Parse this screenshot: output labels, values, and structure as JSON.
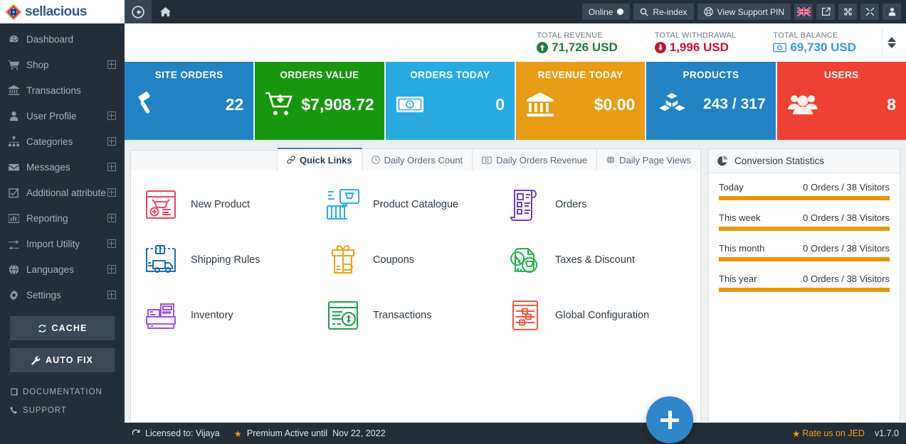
{
  "brand": {
    "name": "sellacious"
  },
  "sidebar": {
    "items": [
      {
        "label": "Dashboard",
        "icon": "dashboard-icon",
        "expandable": false
      },
      {
        "label": "Shop",
        "icon": "cart-icon",
        "expandable": true
      },
      {
        "label": "Transactions",
        "icon": "bank-icon",
        "expandable": false
      },
      {
        "label": "User Profile",
        "icon": "user-icon",
        "expandable": true
      },
      {
        "label": "Categories",
        "icon": "sitemap-icon",
        "expandable": true
      },
      {
        "label": "Messages",
        "icon": "envelope-icon",
        "expandable": true
      },
      {
        "label": "Additional attribute",
        "icon": "checkbox-icon",
        "expandable": true
      },
      {
        "label": "Reporting",
        "icon": "bar-chart-icon",
        "expandable": true
      },
      {
        "label": "Import Utility",
        "icon": "exchange-icon",
        "expandable": true
      },
      {
        "label": "Languages",
        "icon": "globe-icon",
        "expandable": true
      },
      {
        "label": "Settings",
        "icon": "gear-icon",
        "expandable": true
      }
    ],
    "buttons": [
      {
        "label": "CACHE",
        "icon": "refresh-icon"
      },
      {
        "label": "AUTO FIX",
        "icon": "wrench-icon"
      }
    ],
    "links": [
      {
        "label": "DOCUMENTATION",
        "icon": "book-icon"
      },
      {
        "label": "SUPPORT",
        "icon": "phone-icon"
      }
    ]
  },
  "topbar": {
    "back": "back-icon",
    "home": "home-icon",
    "online_label": "Online",
    "reindex_label": "Re-index",
    "support_pin_label": "View Support PIN",
    "icons": [
      "uk-flag-icon",
      "external-link-icon",
      "joomla-icon",
      "expand-icon",
      "user-icon"
    ]
  },
  "summary": [
    {
      "title": "TOTAL REVENUE",
      "value": "71,726 USD",
      "icon": "arrow-up-circle-icon",
      "color": "#1F7A3C",
      "cls": "sum-rev"
    },
    {
      "title": "TOTAL WITHDRAWAL",
      "value": "1,996 USD",
      "icon": "arrow-down-circle-icon",
      "color": "#C8102E",
      "cls": "sum-wd"
    },
    {
      "title": "TOTAL BALANCE",
      "value": "69,730 USD",
      "icon": "money-icon",
      "color": "#3498db",
      "cls": "sum-bal"
    }
  ],
  "kpis": [
    {
      "title": "SITE ORDERS",
      "value": "22",
      "color": "#2183C4",
      "icon": "gavel-icon"
    },
    {
      "title": "ORDERS VALUE",
      "value": "$7,908.72",
      "color": "#18970E",
      "icon": "cart-down-icon"
    },
    {
      "title": "ORDERS TODAY",
      "value": "0",
      "color": "#29ABE2",
      "icon": "banknote-icon"
    },
    {
      "title": "REVENUE TODAY",
      "value": "$0.00",
      "color": "#E89C16",
      "icon": "bank-icon"
    },
    {
      "title": "PRODUCTS",
      "value": "243 / 317",
      "color": "#2183C4",
      "icon": "boxes-icon"
    },
    {
      "title": "USERS",
      "value": "8",
      "color": "#EE4136",
      "icon": "users-icon"
    }
  ],
  "tabs": [
    {
      "label": "Quick Links",
      "icon": "link-icon",
      "active": true
    },
    {
      "label": "Daily Orders Count",
      "icon": "clock-icon",
      "active": false
    },
    {
      "label": "Daily Orders Revenue",
      "icon": "money-icon",
      "active": false
    },
    {
      "label": "Daily Page Views",
      "icon": "globe-icon",
      "active": false
    }
  ],
  "quick_links": [
    {
      "label": "New Product",
      "icon": "new-product-icon",
      "color": "#E8455C"
    },
    {
      "label": "Product Catalogue",
      "icon": "product-catalogue-icon",
      "color": "#29ABE2"
    },
    {
      "label": "Orders",
      "icon": "orders-icon",
      "color": "#6B3FC4"
    },
    {
      "label": "Shipping Rules",
      "icon": "shipping-rules-icon",
      "color": "#1B6FA8"
    },
    {
      "label": "Coupons",
      "icon": "coupons-icon",
      "color": "#E8A317"
    },
    {
      "label": "Taxes & Discount",
      "icon": "taxes-discount-icon",
      "color": "#22B24C"
    },
    {
      "label": "Inventory",
      "icon": "inventory-icon",
      "color": "#A44FD6"
    },
    {
      "label": "Transactions",
      "icon": "transactions-icon",
      "color": "#1E9E4A"
    },
    {
      "label": "Global Configuration",
      "icon": "global-config-icon",
      "color": "#F2563F"
    }
  ],
  "conversion": {
    "title": "Conversion Statistics",
    "icon": "pie-chart-icon",
    "bar_color": "#E8940C",
    "rows": [
      {
        "label": "Today",
        "value": "0 Orders / 38 Visitors",
        "percent": 100
      },
      {
        "label": "This week",
        "value": "0 Orders / 38 Visitors",
        "percent": 100
      },
      {
        "label": "This month",
        "value": "0 Orders / 38 Visitors",
        "percent": 100
      },
      {
        "label": "This year",
        "value": "0 Orders / 38 Visitors",
        "percent": 100
      }
    ]
  },
  "fab": {
    "icon": "plus-icon"
  },
  "footer": {
    "licensed_label": "Licensed to: Vijaya",
    "premium_label": "Premium Active until",
    "premium_date": "Nov 22, 2022",
    "rate_label": "Rate us on JED",
    "version": "v1.7.0"
  },
  "chart_data": {
    "type": "bar",
    "title": "Conversion Statistics",
    "categories": [
      "Today",
      "This week",
      "This month",
      "This year"
    ],
    "values": [
      100,
      100,
      100,
      100
    ],
    "labels": [
      "0 Orders / 38 Visitors",
      "0 Orders / 38 Visitors",
      "0 Orders / 38 Visitors",
      "0 Orders / 38 Visitors"
    ],
    "orders": [
      0,
      0,
      0,
      0
    ],
    "visitors": [
      38,
      38,
      38,
      38
    ],
    "xlabel": "",
    "ylabel": "",
    "ylim": [
      0,
      100
    ],
    "grid": false,
    "legend": "none"
  }
}
